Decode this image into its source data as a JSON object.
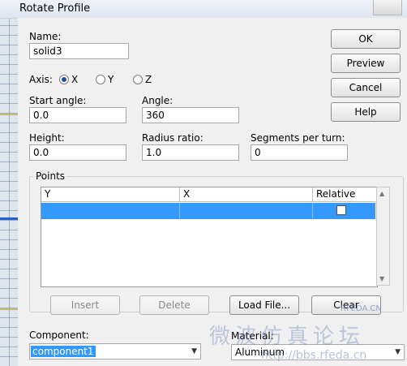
{
  "window": {
    "title": "Rotate Profile"
  },
  "name": {
    "label": "Name:",
    "value": "solid3"
  },
  "axis": {
    "label": "Axis:",
    "options": [
      {
        "label": "X",
        "checked": true
      },
      {
        "label": "Y",
        "checked": false
      },
      {
        "label": "Z",
        "checked": false
      }
    ]
  },
  "start_angle": {
    "label": "Start angle:",
    "value": "0.0"
  },
  "angle": {
    "label": "Angle:",
    "value": "360"
  },
  "height": {
    "label": "Height:",
    "value": "0.0"
  },
  "radius_ratio": {
    "label": "Radius ratio:",
    "value": "1.0"
  },
  "segments": {
    "label": "Segments per turn:",
    "value": "0"
  },
  "buttons": {
    "ok": "OK",
    "preview": "Preview",
    "cancel": "Cancel",
    "help": "Help"
  },
  "points": {
    "label": "Points",
    "columns": [
      "Y",
      "X",
      "Relative"
    ],
    "rows": [
      {
        "y": "",
        "x": "",
        "relative": false,
        "selected": true
      }
    ]
  },
  "point_buttons": {
    "insert": "Insert",
    "delete": "Delete",
    "load_file": "Load File...",
    "clear": "Clear"
  },
  "component": {
    "label": "Component:",
    "value": "component1"
  },
  "material": {
    "label": "Material:",
    "value": "Aluminum"
  },
  "watermark": {
    "text1": "RFEDA.CN",
    "text2": "微波仿真论坛",
    "text3": "http://bbs.rfeda.cn"
  }
}
